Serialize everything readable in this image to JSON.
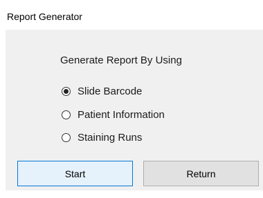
{
  "window": {
    "title": "Report Generator"
  },
  "form": {
    "group_label": "Generate Report By Using",
    "options": [
      {
        "label": "Slide Barcode",
        "selected": true
      },
      {
        "label": "Patient Information",
        "selected": false
      },
      {
        "label": "Staining Runs",
        "selected": false
      }
    ]
  },
  "buttons": {
    "start": "Start",
    "return": "Return"
  },
  "colors": {
    "client_bg": "#f0f0f0",
    "focused_button_border": "#0078d7",
    "focused_button_bg": "#e5f1fb",
    "button_bg": "#e1e1e1"
  }
}
